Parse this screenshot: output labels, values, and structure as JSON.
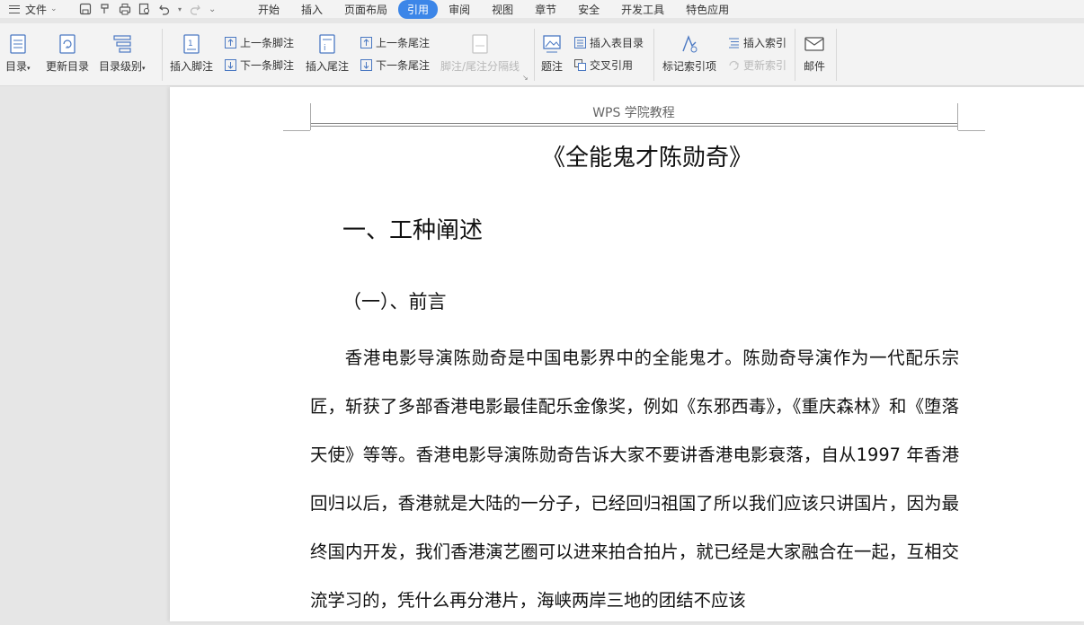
{
  "menu": {
    "file_label": "文件",
    "tabs": [
      {
        "label": "开始"
      },
      {
        "label": "插入"
      },
      {
        "label": "页面布局"
      },
      {
        "label": "引用"
      },
      {
        "label": "审阅"
      },
      {
        "label": "视图"
      },
      {
        "label": "章节"
      },
      {
        "label": "安全"
      },
      {
        "label": "开发工具"
      },
      {
        "label": "特色应用"
      }
    ],
    "active_tab": "引用",
    "accent_color": "#3c86e8"
  },
  "ribbon": {
    "toc": "目录",
    "update_toc": "更新目录",
    "toc_level": "目录级别",
    "insert_footnote": "插入脚注",
    "prev_footnote": "上一条脚注",
    "next_footnote": "下一条脚注",
    "insert_endnote": "插入尾注",
    "prev_endnote": "上一条尾注",
    "next_endnote": "下一条尾注",
    "note_separator": "脚注/尾注分隔线",
    "caption": "题注",
    "insert_table_of_figures": "插入表目录",
    "cross_reference": "交叉引用",
    "mark_index_entry": "标记索引项",
    "insert_index": "插入索引",
    "update_index": "更新索引",
    "mail": "邮件"
  },
  "document": {
    "header_text": "WPS 学院教程",
    "title": "《全能鬼才陈勋奇》",
    "heading1": "一、工种阐述",
    "heading2": "（一）、前言",
    "paragraph": "香港电影导演陈勋奇是中国电影界中的全能鬼才。陈勋奇导演作为一代配乐宗匠，斩获了多部香港电影最佳配乐金像奖，例如《东邪西毒》，《重庆森林》和《堕落天使》等等。香港电影导演陈勋奇告诉大家不要讲香港电影衰落，自从1997 年香港回归以后，香港就是大陆的一分子，已经回归祖国了所以我们应该只讲国片，因为最终国内开发，我们香港演艺圈可以进来拍合拍片，就已经是大家融合在一起，互相交流学习的，凭什么再分港片，海峡两岸三地的团结不应该"
  }
}
